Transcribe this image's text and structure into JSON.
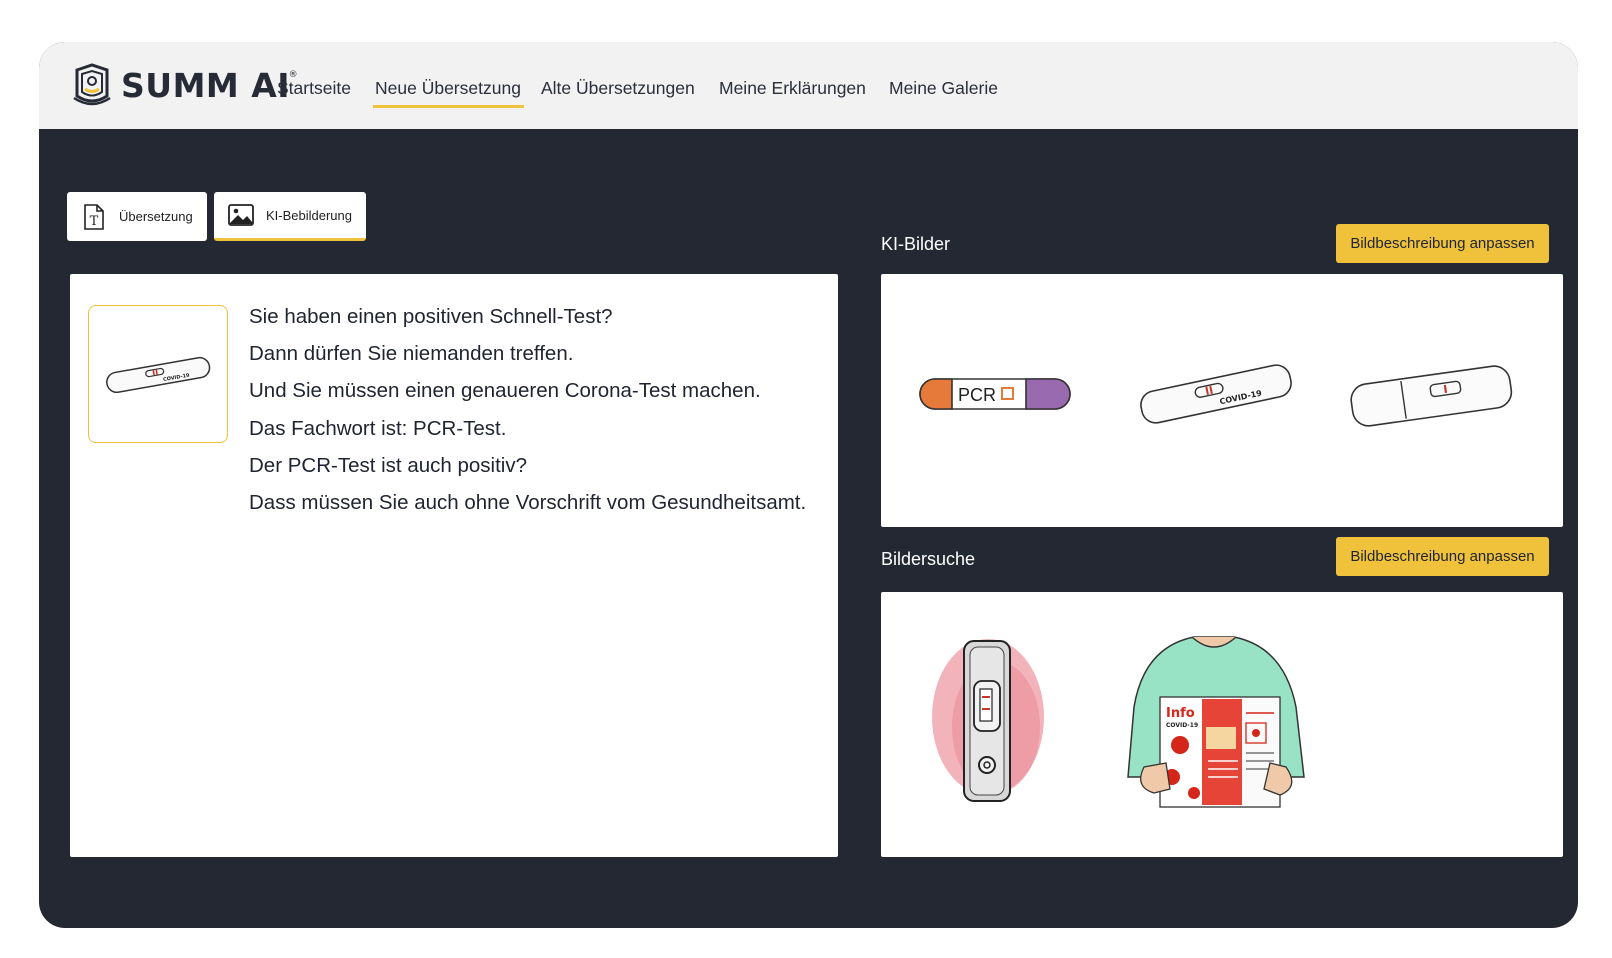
{
  "brand": {
    "name": "SUMM AI",
    "mark": "®"
  },
  "nav": {
    "items": [
      {
        "label": "Startseite"
      },
      {
        "label": "Neue Übersetzung",
        "active": true
      },
      {
        "label": "Alte Übersetzungen"
      },
      {
        "label": "Meine Erklärungen"
      },
      {
        "label": "Meine Galerie"
      }
    ]
  },
  "tabs": [
    {
      "label": "Übersetzung",
      "icon": "text-document-icon"
    },
    {
      "label": "KI-Bebilderung",
      "icon": "image-icon",
      "active": true
    }
  ],
  "translation": {
    "sentences": [
      "Sie haben einen positiven Schnell-Test?",
      "Dann dürfen Sie niemanden treffen.",
      "Und Sie müssen einen genaueren Corona-Test machen.",
      "Das Fachwort ist: PCR-Test.",
      "Der PCR-Test ist auch positiv?",
      "Dass müssen Sie auch ohne Vorschrift vom Gesundheitsamt."
    ],
    "selected_image_text": "COVID-19"
  },
  "ki_bilder": {
    "title": "KI-Bilder",
    "button_label": "Bildbeschreibung anpassen",
    "images": [
      {
        "icon": "pcr-tube-icon",
        "text": "PCR"
      },
      {
        "icon": "covid-test-cassette-icon",
        "text": "COVID-19"
      },
      {
        "icon": "rapid-test-cassette-icon"
      }
    ]
  },
  "bildersuche": {
    "title": "Bildersuche",
    "button_label": "Bildbeschreibung anpassen",
    "images": [
      {
        "icon": "self-test-device-icon"
      },
      {
        "icon": "person-reading-flyer-icon",
        "headline": "Info",
        "subline": "COVID-19"
      }
    ]
  },
  "colors": {
    "accent": "#f0c23b",
    "dark_background": "#232833",
    "nav_background": "#f2f2f2",
    "text": "#1f2430"
  }
}
